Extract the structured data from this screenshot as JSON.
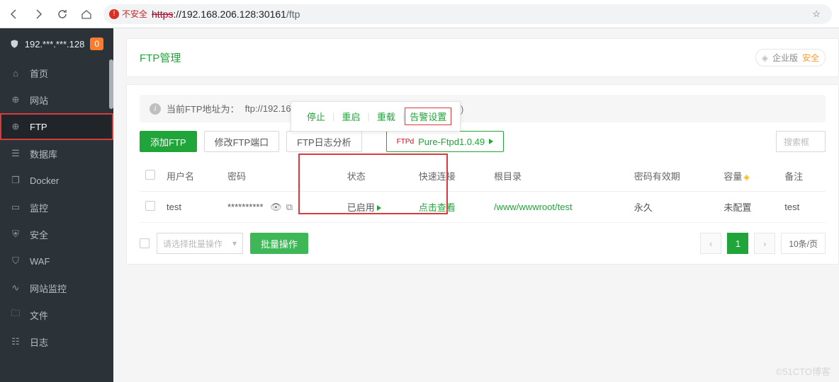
{
  "browser": {
    "insecure_label": "不安全",
    "url_scheme": "https",
    "url_host": "://192.168.206.128:30161",
    "url_path": "/ftp"
  },
  "sidebar": {
    "host": "192.***.***.128",
    "badge": "0",
    "items": [
      {
        "label": "首页",
        "icon": "home-icon"
      },
      {
        "label": "网站",
        "icon": "globe-icon"
      },
      {
        "label": "FTP",
        "icon": "globe-icon"
      },
      {
        "label": "数据库",
        "icon": "database-icon"
      },
      {
        "label": "Docker",
        "icon": "docker-icon"
      },
      {
        "label": "监控",
        "icon": "monitor-icon"
      },
      {
        "label": "安全",
        "icon": "shield-icon"
      },
      {
        "label": "WAF",
        "icon": "waf-icon"
      },
      {
        "label": "网站监控",
        "icon": "chart-icon"
      },
      {
        "label": "文件",
        "icon": "folder-icon"
      },
      {
        "label": "日志",
        "icon": "log-icon"
      }
    ]
  },
  "header": {
    "title": "FTP管理",
    "enterprise": "企业版",
    "upgrade": "安全"
  },
  "info": {
    "prefix": "当前FTP地址为：",
    "addr": "ftp://192.168.206.128:21",
    "tail": "源)"
  },
  "popover": {
    "stop": "停止",
    "restart": "重启",
    "reload": "重载",
    "alarm": "告警设置"
  },
  "actions": {
    "add": "添加FTP",
    "port": "修改FTP端口",
    "log": "FTP日志分析",
    "soft_tag": "FTPd",
    "soft_name": "Pure-Ftpd1.0.49",
    "search": "搜索框"
  },
  "table": {
    "cols": {
      "user": "用户名",
      "pwd": "密码",
      "status": "状态",
      "quick": "快速连接",
      "root": "根目录",
      "expire": "密码有效期",
      "quota": "容量",
      "note": "备注"
    },
    "rows": [
      {
        "user": "test",
        "pwd": "**********",
        "status": "已启用",
        "quick": "点击查看",
        "root": "/www/wwwroot/test",
        "expire": "永久",
        "quota": "未配置",
        "note": "test"
      }
    ]
  },
  "footer": {
    "batch_ph": "请选择批量操作",
    "batch_btn": "批量操作",
    "page": "1",
    "per": "10条/页"
  },
  "watermark": "©51CTO博客"
}
